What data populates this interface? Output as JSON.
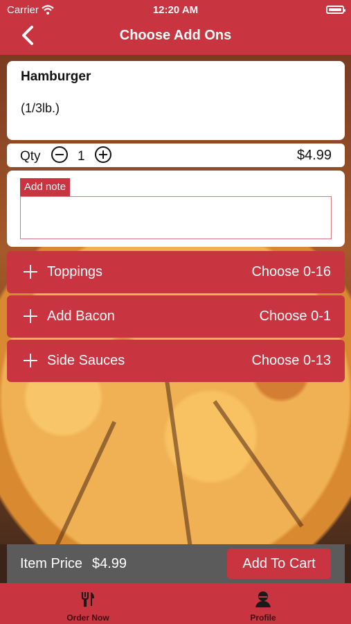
{
  "status_bar": {
    "carrier": "Carrier",
    "time": "12:20 AM"
  },
  "nav": {
    "title": "Choose Add Ons",
    "back_icon": "chevron-left-icon"
  },
  "item": {
    "name": "Hamburger",
    "description": "(1/3lb.)"
  },
  "quantity": {
    "label": "Qty",
    "value": "1",
    "price": "$4.99"
  },
  "note": {
    "label": "Add note",
    "value": ""
  },
  "options": [
    {
      "name": "Toppings",
      "choose": "Choose 0-16"
    },
    {
      "name": "Add Bacon",
      "choose": "Choose 0-1"
    },
    {
      "name": "Side Sauces",
      "choose": "Choose 0-13"
    }
  ],
  "footer": {
    "item_price_label": "Item Price",
    "item_price_value": "$4.99",
    "add_to_cart": "Add To Cart"
  },
  "tabs": [
    {
      "label": "Order Now",
      "icon": "utensils-icon"
    },
    {
      "label": "Profile",
      "icon": "user-icon"
    }
  ],
  "colors": {
    "brand": "#c8343f",
    "price_bar": "#5b5b5b"
  }
}
